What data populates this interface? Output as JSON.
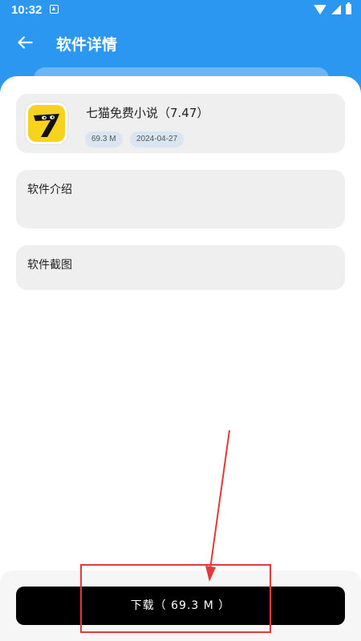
{
  "status_bar": {
    "time": "10:32"
  },
  "header": {
    "title": "软件详情",
    "back_icon": "back-arrow-icon"
  },
  "app": {
    "name": "七猫免费小说（7.47）",
    "size": "69.3 M",
    "date": "2024-04-27",
    "icon": "qimao-app-icon"
  },
  "sections": {
    "intro_label": "软件介绍",
    "screenshots_label": "软件截图"
  },
  "download": {
    "label": "下载（ 69.3 M ）"
  },
  "colors": {
    "header_bg": "#2b97f0",
    "card_bg": "#efefef",
    "tag_bg": "#d9e6f1",
    "button_bg": "#000000",
    "annotation": "#e03a3a",
    "icon_yellow": "#f7d21e"
  }
}
